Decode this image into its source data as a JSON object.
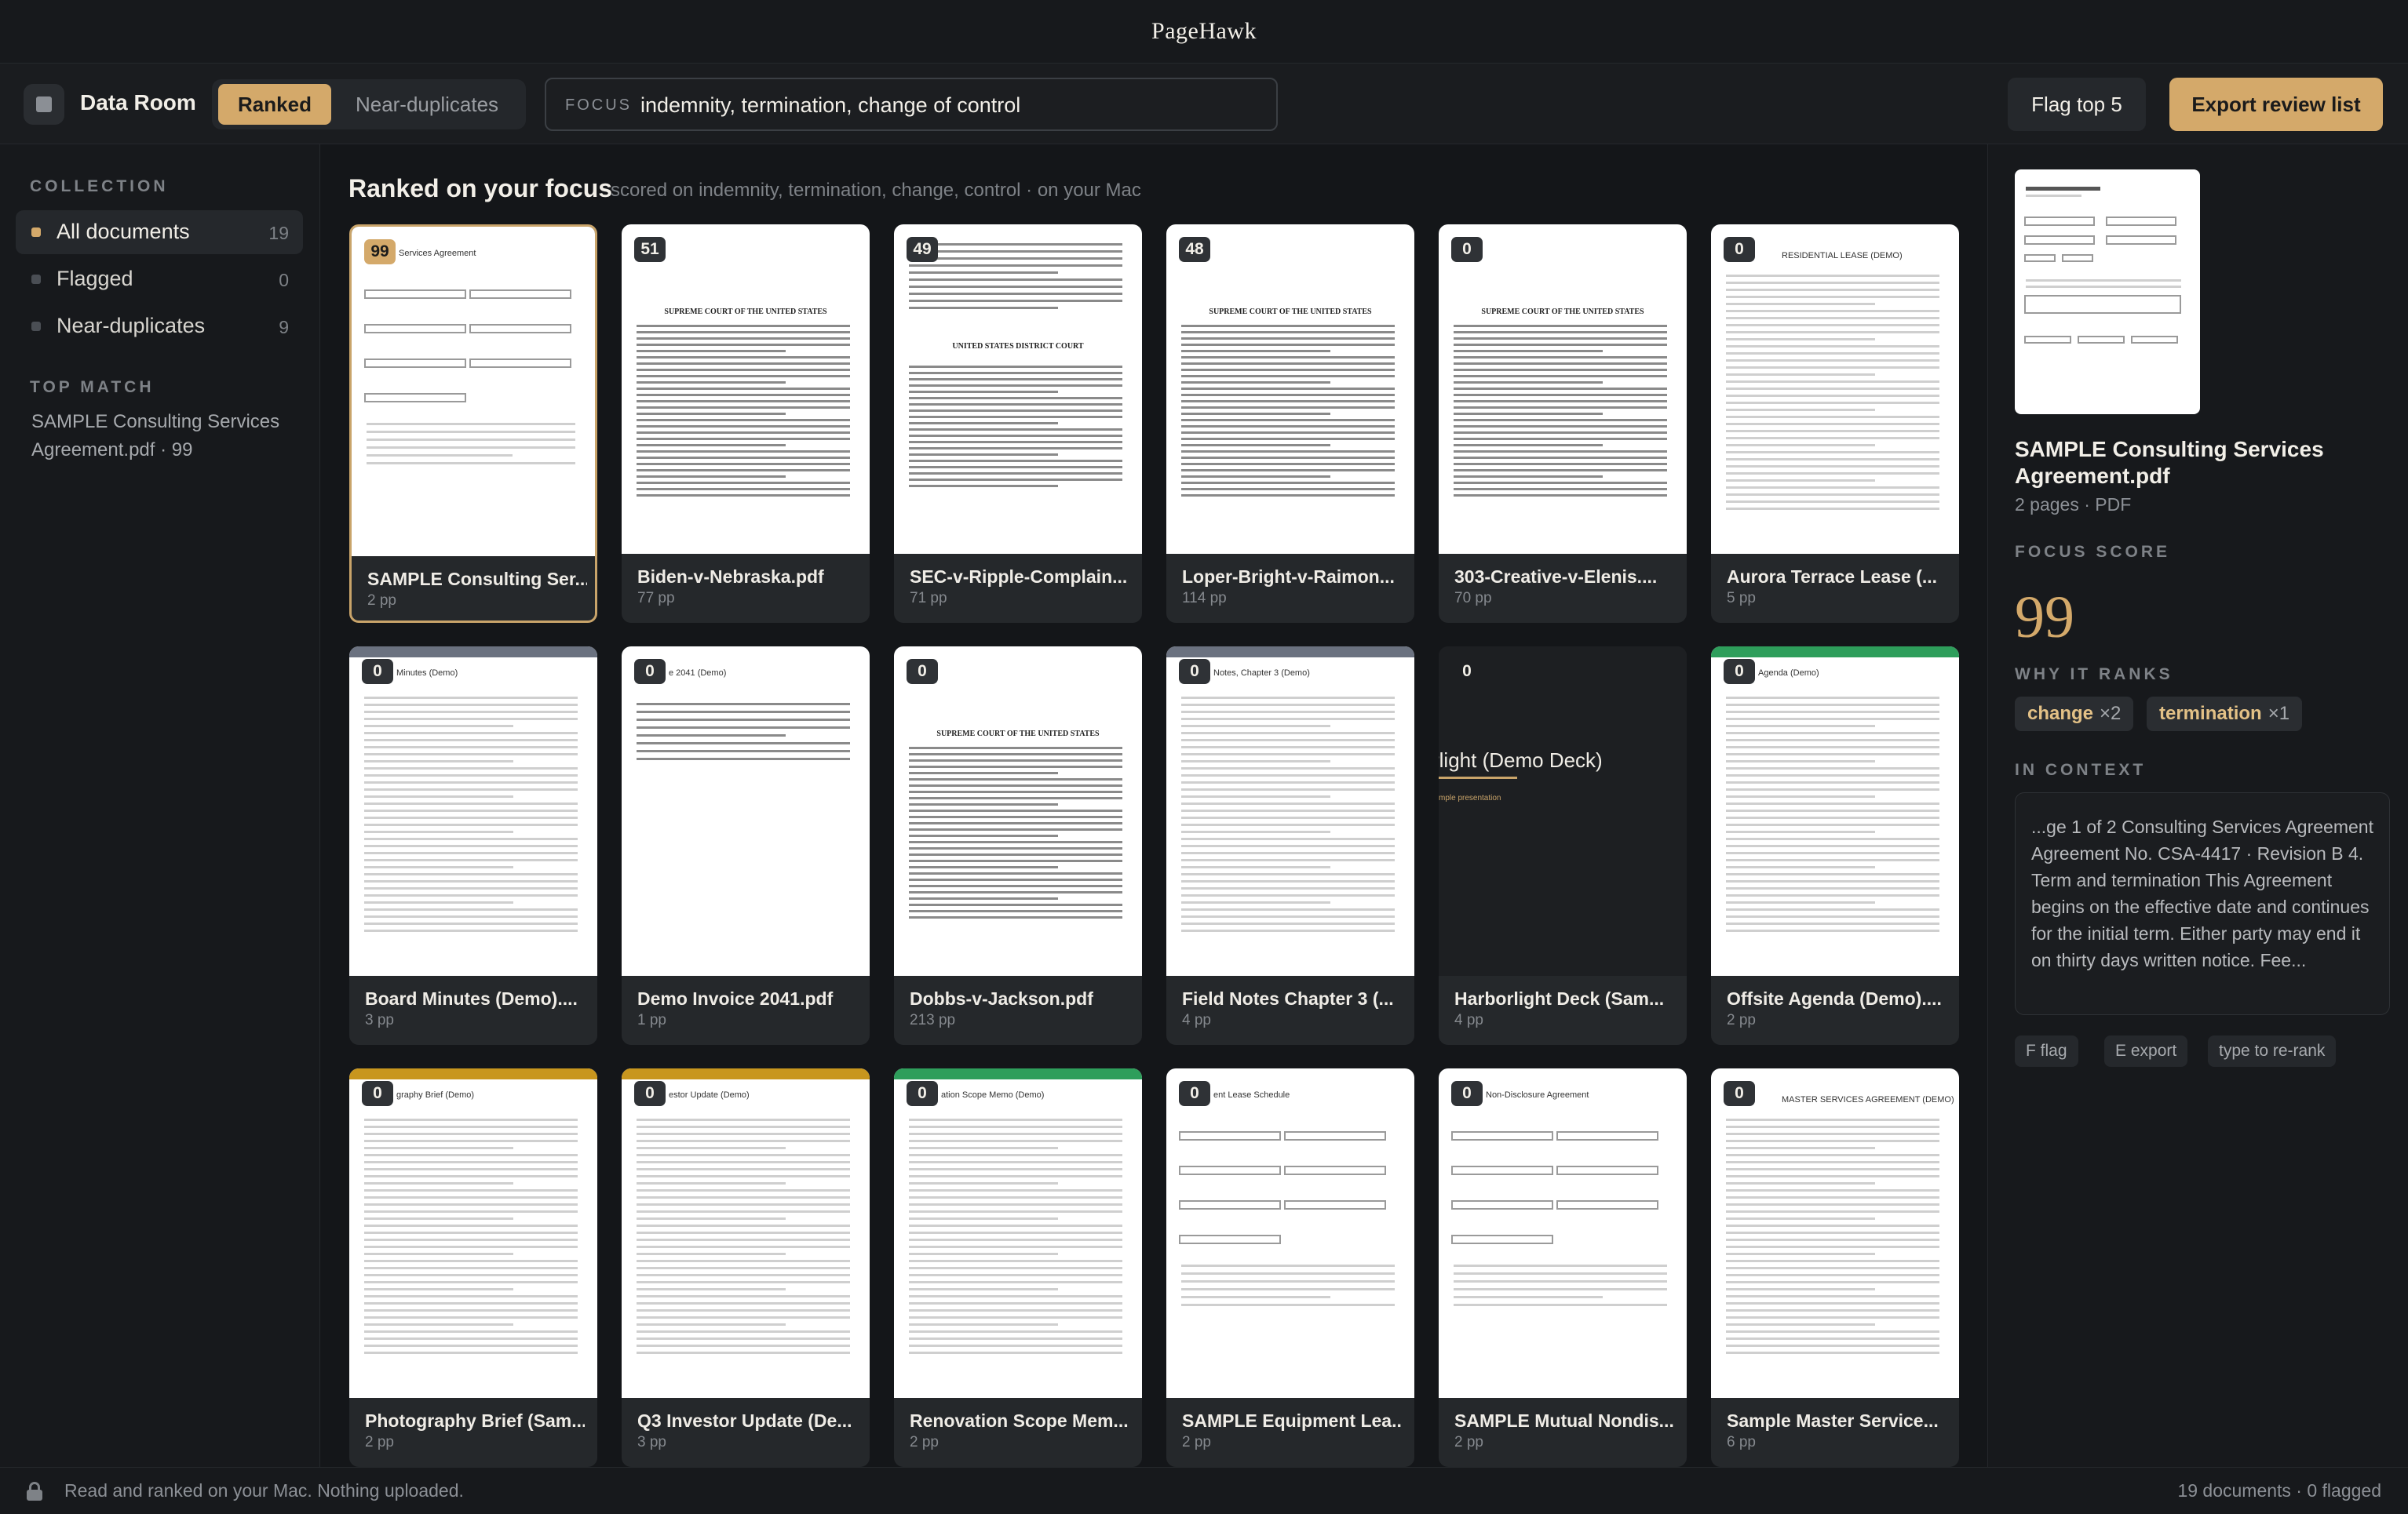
{
  "app": {
    "title": "PageHawk"
  },
  "toolbar": {
    "room_title": "Data Room",
    "view_ranked": "Ranked",
    "view_near_duplicates": "Near-duplicates",
    "focus_label": "FOCUS",
    "focus_value": "indemnity, termination, change of control",
    "flag_button": "Flag top 5",
    "export_button": "Export review list"
  },
  "sidebar": {
    "collection_heading": "COLLECTION",
    "items": [
      {
        "label": "All documents",
        "count": "19",
        "active": true
      },
      {
        "label": "Flagged",
        "count": "0",
        "active": false
      },
      {
        "label": "Near-duplicates",
        "count": "9",
        "active": false
      }
    ],
    "top_match_heading": "TOP MATCH",
    "top_match_text": "SAMPLE Consulting Services Agreement.pdf · 99"
  },
  "main": {
    "title": "Ranked on your focus",
    "subtitle": "scored on indemnity, termination, change, control · on your Mac",
    "cards": [
      {
        "score": "99",
        "name": "SAMPLE Consulting Ser...",
        "pages": "2 pp",
        "thumb_title": "Services Agreement"
      },
      {
        "score": "51",
        "name": "Biden-v-Nebraska.pdf",
        "pages": "77 pp",
        "thumb_title": "SUPREME COURT OF THE UNITED STATES"
      },
      {
        "score": "49",
        "name": "SEC-v-Ripple-Complain...",
        "pages": "71 pp",
        "thumb_title": "UNITED STATES DISTRICT COURT"
      },
      {
        "score": "48",
        "name": "Loper-Bright-v-Raimon...",
        "pages": "114 pp",
        "thumb_title": "SUPREME COURT OF THE UNITED STATES"
      },
      {
        "score": "0",
        "name": "303-Creative-v-Elenis....",
        "pages": "70 pp",
        "thumb_title": "SUPREME COURT OF THE UNITED STATES"
      },
      {
        "score": "0",
        "name": "Aurora Terrace Lease (...",
        "pages": "5 pp",
        "thumb_title": "RESIDENTIAL LEASE (DEMO)"
      },
      {
        "score": "0",
        "name": "Board Minutes (Demo)....",
        "pages": "3 pp",
        "thumb_title": "Minutes (Demo)"
      },
      {
        "score": "0",
        "name": "Demo Invoice 2041.pdf",
        "pages": "1 pp",
        "thumb_title": "e 2041 (Demo)"
      },
      {
        "score": "0",
        "name": "Dobbs-v-Jackson.pdf",
        "pages": "213 pp",
        "thumb_title": "SUPREME COURT OF THE UNITED STATES"
      },
      {
        "score": "0",
        "name": "Field Notes Chapter 3 (...",
        "pages": "4 pp",
        "thumb_title": "Notes, Chapter 3 (Demo)"
      },
      {
        "score": "0",
        "name": "Harborlight Deck (Sam...",
        "pages": "4 pp",
        "thumb_title": "rlight (Demo Deck)",
        "thumb_sub": "mple presentation"
      },
      {
        "score": "0",
        "name": "Offsite Agenda (Demo)....",
        "pages": "2 pp",
        "thumb_title": "Agenda (Demo)"
      },
      {
        "score": "0",
        "name": "Photography Brief (Sam...",
        "pages": "2 pp",
        "thumb_title": "graphy Brief (Demo)"
      },
      {
        "score": "0",
        "name": "Q3 Investor Update (De...",
        "pages": "3 pp",
        "thumb_title": "estor Update (Demo)"
      },
      {
        "score": "0",
        "name": "Renovation Scope Mem...",
        "pages": "2 pp",
        "thumb_title": "ation Scope Memo (Demo)"
      },
      {
        "score": "0",
        "name": "SAMPLE Equipment Lea...",
        "pages": "2 pp",
        "thumb_title": "ent Lease Schedule"
      },
      {
        "score": "0",
        "name": "SAMPLE Mutual Nondis...",
        "pages": "2 pp",
        "thumb_title": "Non-Disclosure Agreement"
      },
      {
        "score": "0",
        "name": "Sample Master Service...",
        "pages": "6 pp",
        "thumb_title": "MASTER SERVICES AGREEMENT (DEMO)"
      }
    ]
  },
  "detail": {
    "name": "SAMPLE Consulting Services Agreement.pdf",
    "meta": "2 pages · PDF",
    "focus_score_heading": "FOCUS SCORE",
    "focus_score": "99",
    "why_heading": "WHY IT RANKS",
    "chips": [
      {
        "term": "change",
        "count": "×2"
      },
      {
        "term": "termination",
        "count": "×1"
      }
    ],
    "context_heading": "IN CONTEXT",
    "context_text": "...ge 1 of 2 Consulting Services Agreement Agreement No. CSA-4417 · Revision B 4. Term and termination This Agreement begins on the effective date and continues for the initial term. Either party may end it on thirty days written notice. Fee...",
    "shortcuts": [
      "F flag",
      "E export",
      "type to re-rank"
    ]
  },
  "footer": {
    "left": "Read and ranked on your Mac. Nothing uploaded.",
    "right": "19 documents · 0 flagged"
  },
  "colors": {
    "accent": "#d4a96a",
    "background": "#141619",
    "panel": "#17191c",
    "card": "#25282b",
    "accent_gray": "#6b7280",
    "accent_gold": "#c8961e",
    "accent_green": "#2e9e5b"
  }
}
